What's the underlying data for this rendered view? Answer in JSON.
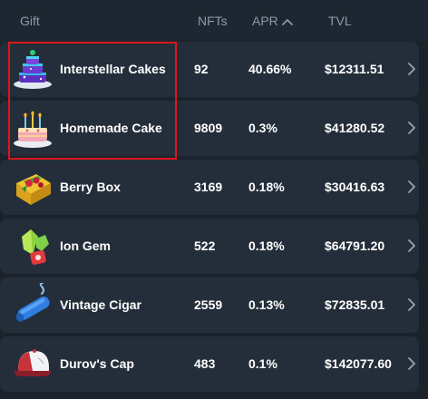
{
  "columns": {
    "gift": "Gift",
    "nfts": "NFTs",
    "apr": "APR",
    "tvl": "TVL"
  },
  "sort": {
    "column": "apr",
    "direction": "descending",
    "icon": "chevron-up-icon"
  },
  "rows": [
    {
      "name": "Interstellar Cakes",
      "nfts": "92",
      "apr": "40.66%",
      "tvl": "$12311.51",
      "icon": "interstellar-cake-icon"
    },
    {
      "name": "Homemade Cake",
      "nfts": "9809",
      "apr": "0.3%",
      "tvl": "$41280.52",
      "icon": "homemade-cake-icon"
    },
    {
      "name": "Berry Box",
      "nfts": "3169",
      "apr": "0.18%",
      "tvl": "$30416.63",
      "icon": "berry-box-icon"
    },
    {
      "name": "Ion Gem",
      "nfts": "522",
      "apr": "0.18%",
      "tvl": "$64791.20",
      "icon": "ion-gem-icon"
    },
    {
      "name": "Vintage Cigar",
      "nfts": "2559",
      "apr": "0.13%",
      "tvl": "$72835.01",
      "icon": "vintage-cigar-icon"
    },
    {
      "name": "Durov's Cap",
      "nfts": "483",
      "apr": "0.1%",
      "tvl": "$142077.60",
      "icon": "durovs-cap-icon"
    }
  ],
  "colors": {
    "background": "#1b222c",
    "row": "#242e3a",
    "header_text": "#8e99a6",
    "highlight": "#e0151c"
  }
}
